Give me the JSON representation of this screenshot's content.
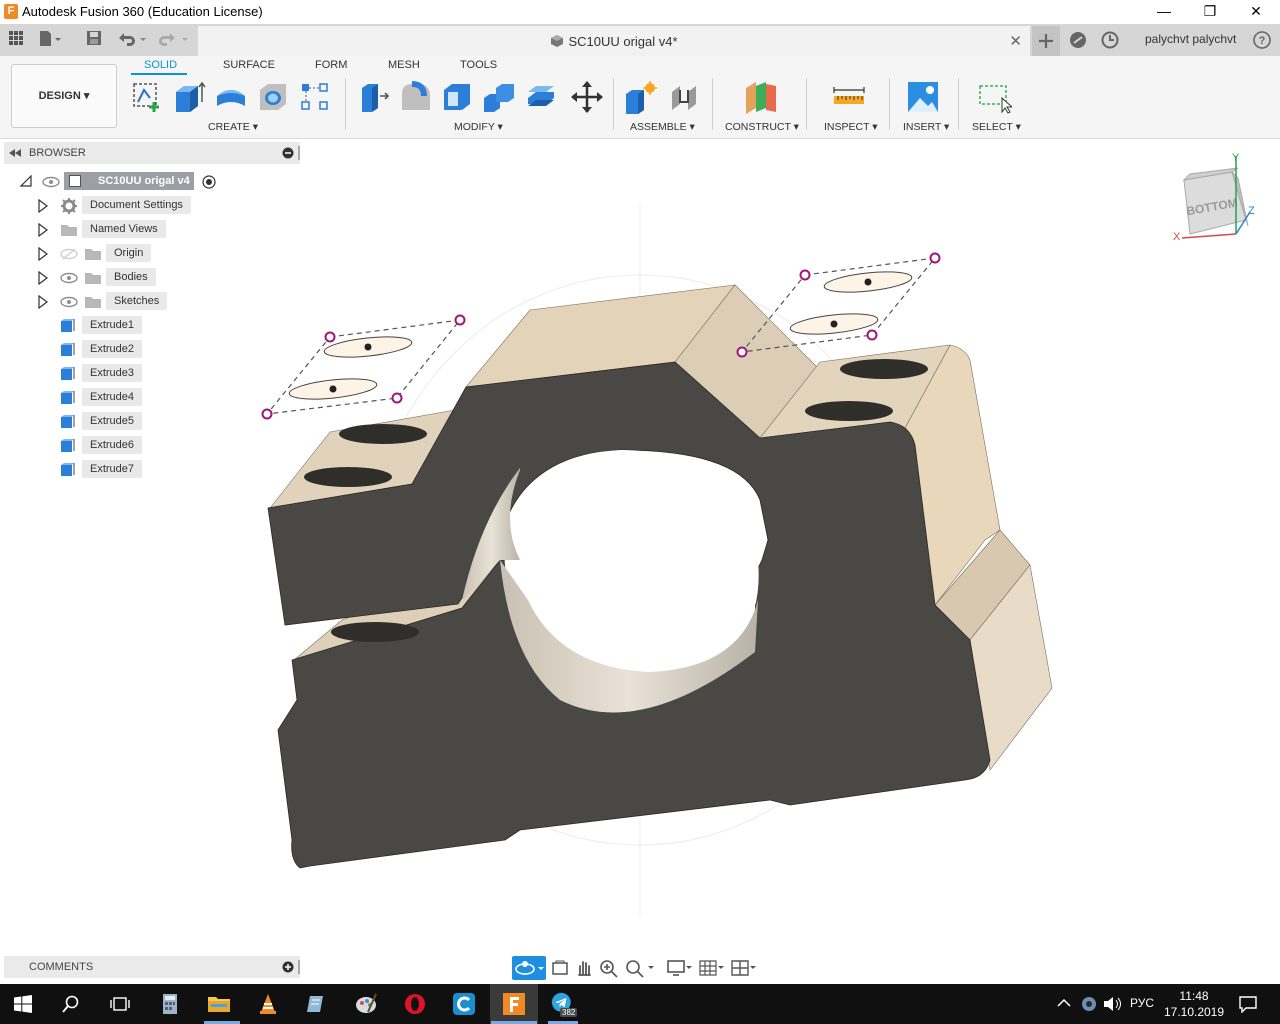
{
  "window": {
    "title": "Autodesk Fusion 360 (Education License)",
    "app_icon_letter": "F",
    "minimize": "—",
    "maximize": "❐",
    "close": "✕"
  },
  "tabbar": {
    "document_tab": "SC10UU origal v4*",
    "tab_close": "✕",
    "user": "palychvt palychvt",
    "help": "?"
  },
  "toolbar": {
    "workspace": "DESIGN ▾",
    "tabs": [
      "SOLID",
      "SURFACE",
      "FORM",
      "MESH",
      "TOOLS"
    ],
    "active_tab": "SOLID",
    "groups": [
      "CREATE ▾",
      "MODIFY ▾",
      "ASSEMBLE ▾",
      "CONSTRUCT ▾",
      "INSPECT ▾",
      "INSERT ▾",
      "SELECT ▾"
    ]
  },
  "browser": {
    "header": "BROWSER",
    "root": "SC10UU origal v4",
    "folders": [
      "Document Settings",
      "Named Views",
      "Origin",
      "Bodies",
      "Sketches"
    ],
    "features": [
      "Extrude1",
      "Extrude2",
      "Extrude3",
      "Extrude4",
      "Extrude5",
      "Extrude6",
      "Extrude7"
    ]
  },
  "comments": {
    "header": "COMMENTS"
  },
  "viewcube": {
    "face_label": "BOTTOM",
    "axis_x": "X",
    "axis_y": "Y",
    "axis_z": "Z"
  },
  "taskbar": {
    "language": "РУС",
    "time": "11:48",
    "date": "17.10.2019",
    "telegram_badge": "382"
  },
  "colors": {
    "accent": "#0696d7",
    "model_dark": "#4a4844",
    "model_light": "#e6d8c2",
    "sketch_points": "#a0157a"
  }
}
